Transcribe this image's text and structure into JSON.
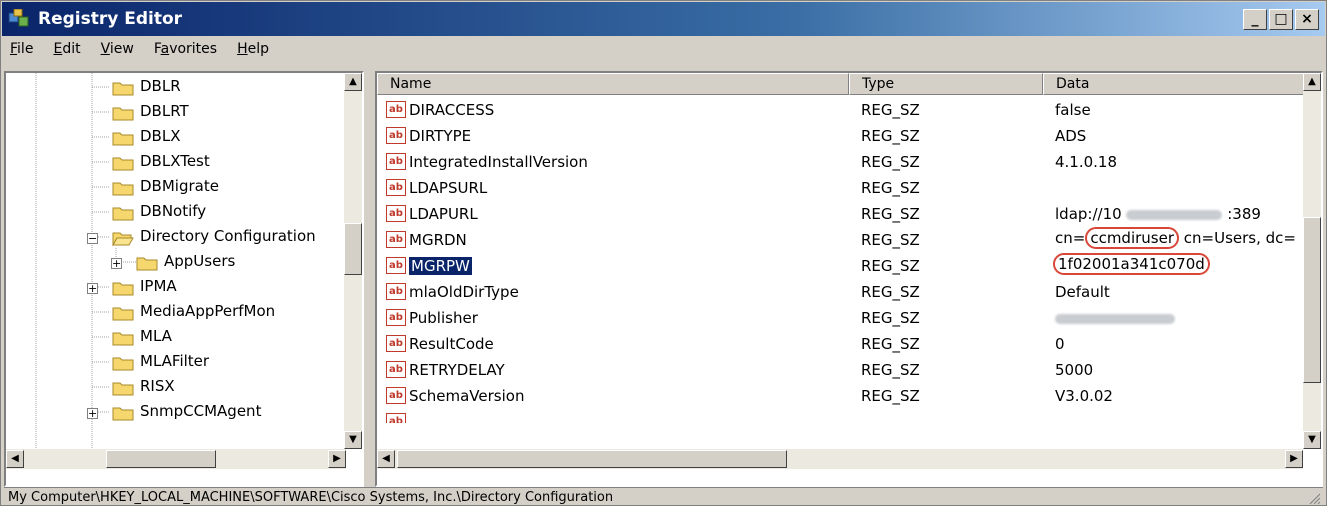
{
  "window": {
    "title": "Registry Editor"
  },
  "title_buttons": {
    "minimize": "_",
    "maximize": "□",
    "close": "×"
  },
  "menu": [
    {
      "label": "File",
      "accel": "F",
      "rest": "ile"
    },
    {
      "label": "Edit",
      "accel": "E",
      "rest": "dit"
    },
    {
      "label": "View",
      "accel": "V",
      "rest": "iew"
    },
    {
      "label": "Favorites",
      "accel": "a",
      "pre": "F",
      "rest": "vorites"
    },
    {
      "label": "Help",
      "accel": "H",
      "rest": "elp"
    }
  ],
  "tree": [
    {
      "label": "DBLR"
    },
    {
      "label": "DBLRT"
    },
    {
      "label": "DBLX"
    },
    {
      "label": "DBLXTest"
    },
    {
      "label": "DBMigrate"
    },
    {
      "label": "DBNotify"
    },
    {
      "label": "Directory Configuration"
    },
    {
      "label": "AppUsers"
    },
    {
      "label": "IPMA"
    },
    {
      "label": "MediaAppPerfMon"
    },
    {
      "label": "MLA"
    },
    {
      "label": "MLAFilter"
    },
    {
      "label": "RISX"
    },
    {
      "label": "SnmpCCMAgent"
    }
  ],
  "columns": {
    "name": "Name",
    "type": "Type",
    "data": "Data"
  },
  "values": [
    {
      "name": "DIRACCESS",
      "type": "REG_SZ",
      "data": "false"
    },
    {
      "name": "DIRTYPE",
      "type": "REG_SZ",
      "data": "ADS"
    },
    {
      "name": "IntegratedInstallVersion",
      "type": "REG_SZ",
      "data": "4.1.0.18"
    },
    {
      "name": "LDAPSURL",
      "type": "REG_SZ",
      "data": ""
    },
    {
      "name": "LDAPURL",
      "type": "REG_SZ",
      "data_prefix": "ldap://10",
      "data_suffix": ":389"
    },
    {
      "name": "MGRDN",
      "type": "REG_SZ",
      "data_prefix": "cn=",
      "data_highlight": "ccmdiruser",
      "data_suffix": " cn=Users, dc="
    },
    {
      "name": "MGRPW",
      "type": "REG_SZ",
      "data_highlight": "1f02001a341c070d"
    },
    {
      "name": "mlaOldDirType",
      "type": "REG_SZ",
      "data": "Default"
    },
    {
      "name": "Publisher",
      "type": "REG_SZ",
      "data": ""
    },
    {
      "name": "ResultCode",
      "type": "REG_SZ",
      "data": "0"
    },
    {
      "name": "RETRYDELAY",
      "type": "REG_SZ",
      "data": "5000"
    },
    {
      "name": "SchemaVersion",
      "type": "REG_SZ",
      "data": "V3.0.02"
    }
  ],
  "icon_text": "ab",
  "status": {
    "path": "My Computer\\HKEY_LOCAL_MACHINE\\SOFTWARE\\Cisco Systems, Inc.\\Directory Configuration"
  },
  "colors": {
    "selection": "#0a246a",
    "highlight_ring": "#d9463a",
    "title_bar": "#0a246a"
  }
}
